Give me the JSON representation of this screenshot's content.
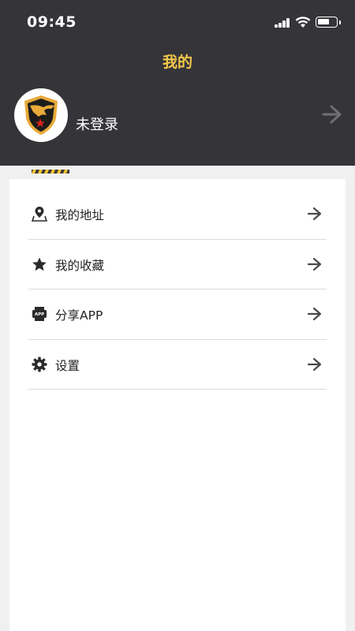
{
  "status_bar": {
    "time": "09:45"
  },
  "header": {
    "title": "我的",
    "background": "#353439",
    "title_color": "#f4c84a"
  },
  "profile": {
    "name": "未登录",
    "avatar_icon": "eagle-shield-logo"
  },
  "menu": {
    "items": [
      {
        "label": "我的地址",
        "icon": "location-map-icon"
      },
      {
        "label": "我的收藏",
        "icon": "star-icon"
      },
      {
        "label": "分享APP",
        "icon": "app-share-icon"
      },
      {
        "label": "设置",
        "icon": "gear-icon"
      }
    ]
  }
}
